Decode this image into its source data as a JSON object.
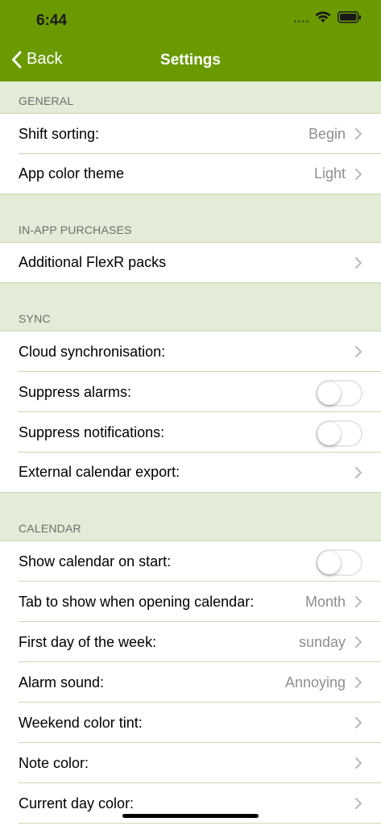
{
  "status_bar": {
    "time": "6:44"
  },
  "nav": {
    "back_label": "Back",
    "title": "Settings"
  },
  "colors": {
    "header_green": "#6a9a00",
    "section_bg": "#e2ecd6",
    "divider": "#c7d9b2"
  },
  "sections": {
    "general": {
      "title": "GENERAL",
      "shift_sorting": {
        "label": "Shift sorting:",
        "value": "Begin"
      },
      "app_color_theme": {
        "label": "App color theme",
        "value": "Light"
      }
    },
    "purchases": {
      "title": "IN-APP PURCHASES",
      "flexr_packs": {
        "label": "Additional FlexR packs"
      }
    },
    "sync": {
      "title": "SYNC",
      "cloud_sync": {
        "label": "Cloud synchronisation:"
      },
      "suppress_alarms": {
        "label": "Suppress alarms:",
        "on": false
      },
      "suppress_notifications": {
        "label": "Suppress notifications:",
        "on": false
      },
      "calendar_export": {
        "label": "External calendar export:"
      }
    },
    "calendar": {
      "title": "CALENDAR",
      "show_on_start": {
        "label": "Show calendar on start:",
        "on": false
      },
      "tab_on_open": {
        "label": "Tab to show when opening calendar:",
        "value": "Month"
      },
      "first_day": {
        "label": "First day of the week:",
        "value": "sunday"
      },
      "alarm_sound": {
        "label": "Alarm sound:",
        "value": "Annoying"
      },
      "weekend_tint": {
        "label": "Weekend color tint:"
      },
      "note_color": {
        "label": "Note color:"
      },
      "current_day_color": {
        "label": "Current day color:"
      }
    }
  }
}
